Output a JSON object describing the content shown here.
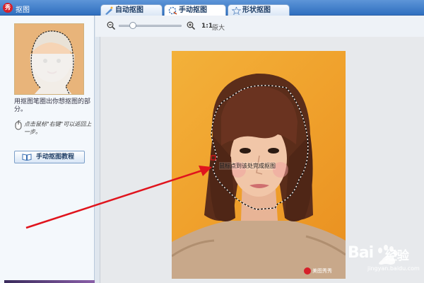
{
  "window": {
    "title": "抠图",
    "logo": "秀"
  },
  "tabs": [
    {
      "label": "自动抠图",
      "icon": "auto-cutout-icon"
    },
    {
      "label": "手动抠图",
      "icon": "manual-cutout-icon",
      "active": true
    },
    {
      "label": "形状抠图",
      "icon": "shape-cutout-icon"
    }
  ],
  "sidebar": {
    "hint": "用抠图笔圈出你想抠图的部分。",
    "tip": "点击鼠标\"右键\"可以返回上一步。",
    "tutorial_button": "手动抠图教程"
  },
  "toolbar": {
    "zoom_ratio": "1:1",
    "original_label": "原大",
    "zoom_slider_value": 0.2
  },
  "canvas": {
    "caption": "鼠标点到该处完成抠图"
  },
  "watermark": {
    "baidu": "Bai",
    "jingyan": "经验",
    "url": "jingyan.baidu.com",
    "meitu": "美图秀秀"
  },
  "colors": {
    "titlebar": "#2f6fbf",
    "arrow": "#e0141d",
    "photo_background": "#f0a22d"
  }
}
